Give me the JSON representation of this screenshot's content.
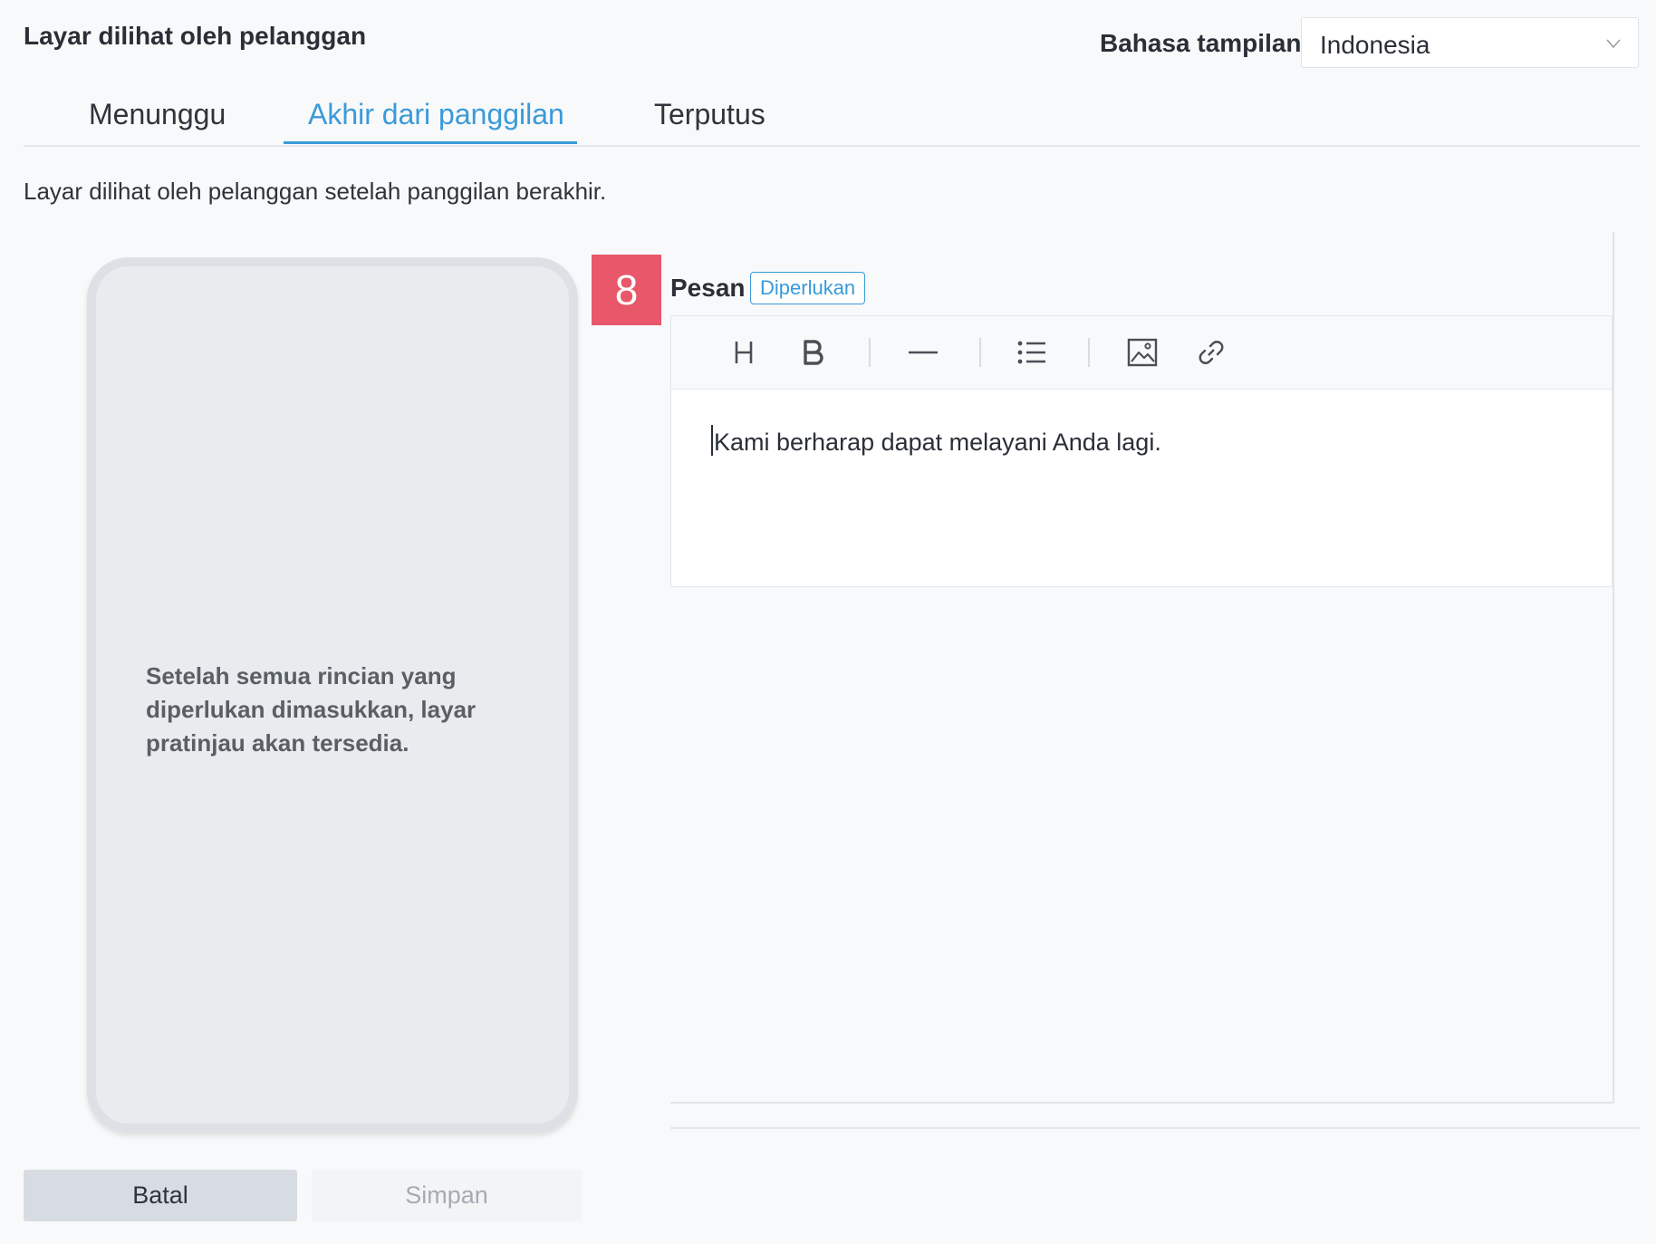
{
  "header": {
    "title": "Layar dilihat oleh pelanggan",
    "language_label": "Bahasa tampilan",
    "language_value": "Indonesia"
  },
  "tabs": [
    {
      "label": "Menunggu",
      "active": false
    },
    {
      "label": "Akhir dari panggilan",
      "active": true
    },
    {
      "label": "Terputus",
      "active": false
    }
  ],
  "description": "Layar dilihat oleh pelanggan setelah panggilan berakhir.",
  "preview": {
    "placeholder": "Setelah semua rincian yang diperlukan dimasukkan, layar pratinjau akan tersedia."
  },
  "step_badge": "8",
  "message_field": {
    "label": "Pesan",
    "required_badge": "Diperlukan",
    "content": "Kami berharap dapat melayani Anda lagi.",
    "toolbar_icons": [
      "heading-icon",
      "bold-icon",
      "horizontal-rule-icon",
      "bullet-list-icon",
      "image-icon",
      "link-icon"
    ]
  },
  "buttons": {
    "cancel": "Batal",
    "save": "Simpan"
  },
  "colors": {
    "accent": "#3a9ad9",
    "badge": "#e8576a"
  }
}
